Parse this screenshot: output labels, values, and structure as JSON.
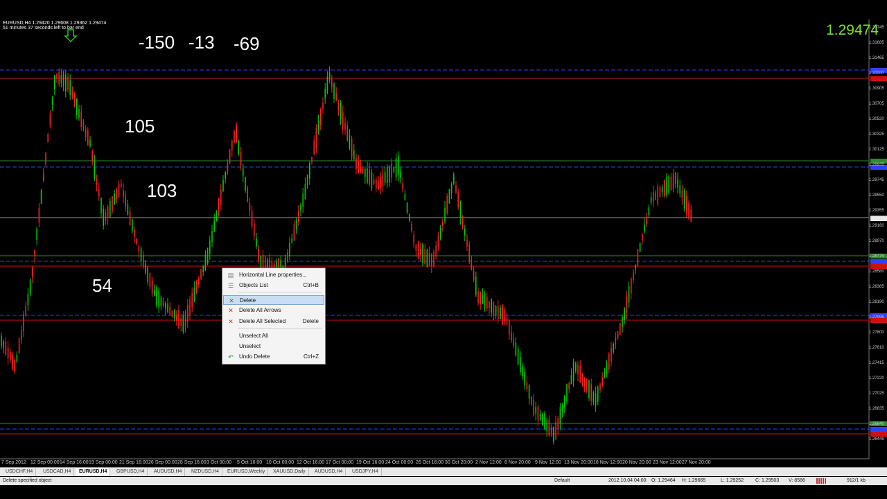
{
  "chart": {
    "symbol_line": "EURUSD,H4  1.29420 1.29608 1.29362 1.29474",
    "timer_line": "51 minutes 37 seconds left to bar end",
    "current_price": "1.29474",
    "annotations": [
      "-150",
      "-13",
      "-69",
      "105",
      "103",
      "54"
    ],
    "price_axis": [
      "1.31745",
      "1.31685",
      "1.31465",
      "1.31100",
      "1.30905",
      "1.30705",
      "1.30520",
      "1.30325",
      "1.30125",
      "1.29935",
      "1.29745",
      "1.29550",
      "1.29355",
      "1.29160",
      "1.28970",
      "1.28775",
      "1.28580",
      "1.28385",
      "1.28190",
      "1.27995",
      "1.27800",
      "1.27610",
      "1.27415",
      "1.27220",
      "1.27025",
      "1.26835",
      "1.26640",
      "1.26445"
    ],
    "time_axis": [
      "7 Sep 2012",
      "12 Sep 00:00",
      "14 Sep 16:00",
      "19 Sep 00:00",
      "21 Sep 16:00",
      "26 Sep 00:00",
      "28 Sep 16:00",
      "3 Oct 00:00",
      "5 Oct 16:00",
      "10 Oct 00:00",
      "12 Oct 16:00",
      "17 Oct 00:00",
      "19 Oct 16:00",
      "24 Oct 00:00",
      "26 Oct 16:00",
      "30 Oct 20:00",
      "2 Nov 12:00",
      "6 Nov 20:00",
      "9 Nov 12:00",
      "13 Nov 20:00",
      "16 Nov 12:00",
      "20 Nov 20:00",
      "23 Nov 12:00",
      "27 Nov 20:00"
    ],
    "colors": {
      "bull": "#00d000",
      "bear": "#ff2020",
      "red_line": "#d01010",
      "green_line": "#2e8b2e",
      "blue_line": "#3040ff",
      "price_text": "#7fe030"
    }
  },
  "context_menu": {
    "items": [
      {
        "label": "Horizontal Line properties...",
        "shortcut": "",
        "icon": "properties-icon"
      },
      {
        "label": "Objects List",
        "shortcut": "Ctrl+B",
        "icon": "list-icon"
      },
      {
        "label": "Delete",
        "shortcut": "",
        "icon": "delete-icon"
      },
      {
        "label": "Delete All Arrows",
        "shortcut": "",
        "icon": "delete-arrows-icon"
      },
      {
        "label": "Delete All Selected",
        "shortcut": "Delete",
        "icon": "delete-selected-icon"
      },
      {
        "label": "Unselect All",
        "shortcut": "",
        "icon": ""
      },
      {
        "label": "Unselect",
        "shortcut": "",
        "icon": ""
      },
      {
        "label": "Undo Delete",
        "shortcut": "Ctrl+Z",
        "icon": "undo-icon"
      }
    ]
  },
  "tabs": [
    "USDCHF,H4",
    "USDCAD,H4",
    "EURUSD,H4",
    "GBPUSD,H4",
    "AUDUSD,H4",
    "NZDUSD,H4",
    "EURUSD,Weekly",
    "XAUUSD,Daily",
    "AUDUSD,H4",
    "USDJPY,H4"
  ],
  "active_tab": "EURUSD,H4",
  "status": {
    "message": "Delete specified object",
    "profile": "Default",
    "datetime": "2012.10.04 04:00",
    "open": "O: 1.29464",
    "high": "H: 1.29665",
    "low": "L: 1.29252",
    "close": "C: 1.29503",
    "volume": "V: 8586",
    "traffic": "912/1 kb"
  }
}
